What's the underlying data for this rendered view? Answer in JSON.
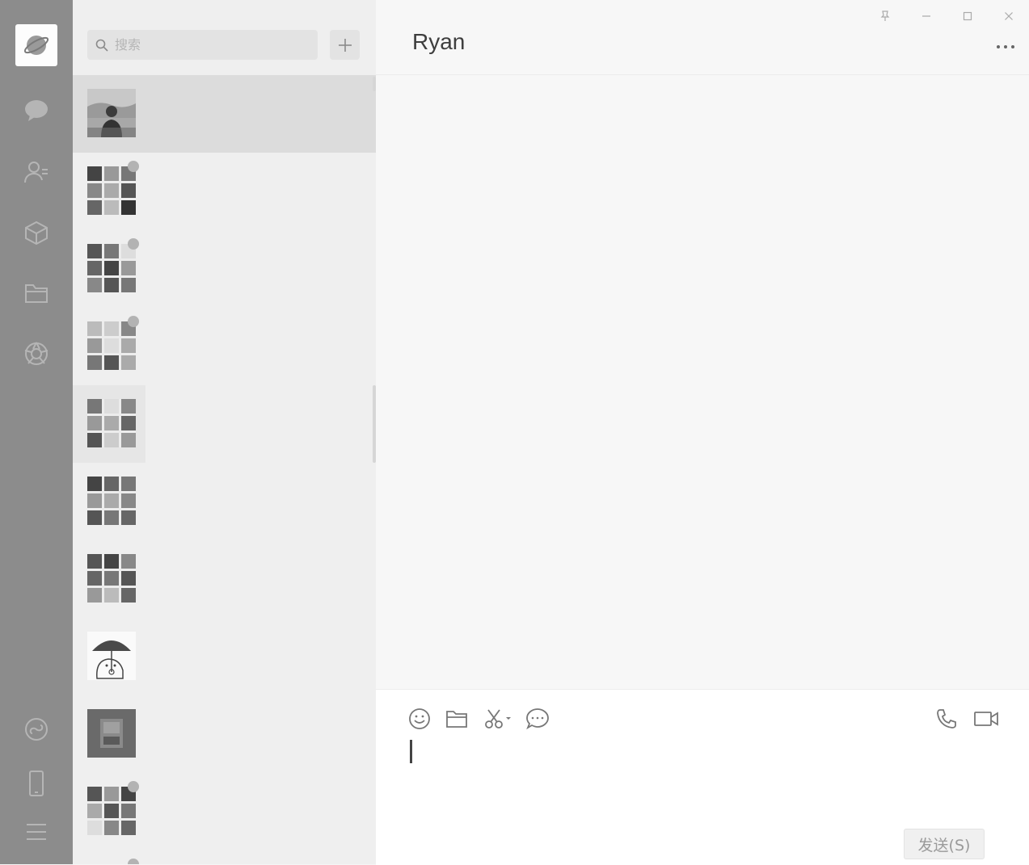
{
  "sidebar": {
    "items": [
      {
        "name": "chat-icon"
      },
      {
        "name": "contacts-icon"
      },
      {
        "name": "collections-icon"
      },
      {
        "name": "files-icon"
      },
      {
        "name": "moments-icon"
      },
      {
        "name": "mini-programs-icon"
      },
      {
        "name": "phone-icon"
      },
      {
        "name": "menu-icon"
      }
    ]
  },
  "search": {
    "placeholder": "搜索",
    "value": ""
  },
  "conversations": [
    {
      "type": "photo",
      "selected": true,
      "badge": false
    },
    {
      "type": "group",
      "selected": false,
      "badge": true
    },
    {
      "type": "group",
      "selected": false,
      "badge": true
    },
    {
      "type": "group",
      "selected": false,
      "badge": true
    },
    {
      "type": "group",
      "selected": false,
      "badge": false
    },
    {
      "type": "group",
      "selected": false,
      "badge": false
    },
    {
      "type": "group",
      "selected": false,
      "badge": false
    },
    {
      "type": "illustration",
      "selected": false,
      "badge": false
    },
    {
      "type": "photo",
      "selected": false,
      "badge": false
    },
    {
      "type": "group",
      "selected": false,
      "badge": true
    }
  ],
  "chat": {
    "title": "Ryan",
    "send_label": "发送(S)",
    "input_value": ""
  },
  "colors": {
    "sidebar_bg": "#8c8c8c",
    "list_bg": "#efefef",
    "selected_bg": "#dcdcdc",
    "chat_bg": "#f7f7f7",
    "input_bg": "#ffffff"
  }
}
